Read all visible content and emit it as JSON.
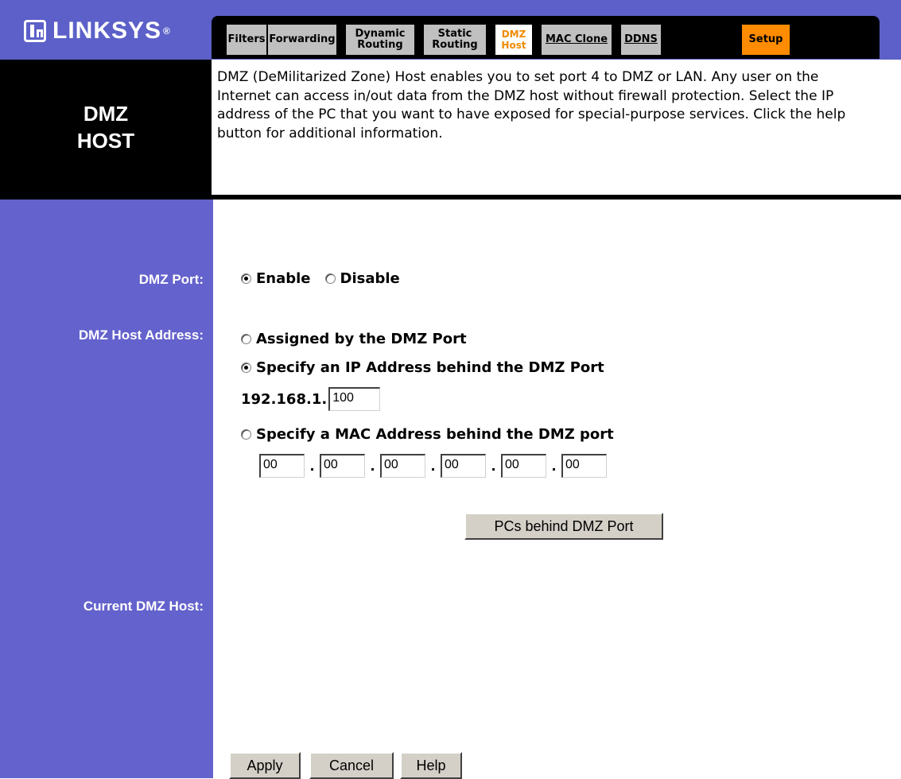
{
  "brand": {
    "name": "LINKSYS",
    "reg_mark": "®"
  },
  "nav": {
    "tabs": [
      {
        "label": "Filters"
      },
      {
        "label": "Forwarding"
      },
      {
        "label": "Dynamic\nRouting"
      },
      {
        "label": "Static\nRouting"
      },
      {
        "label": "DMZ\nHost",
        "active": true
      },
      {
        "label": "MAC Clone"
      },
      {
        "label": "DDNS"
      },
      {
        "label": "Setup"
      }
    ]
  },
  "section": {
    "title": "DMZ\nHOST",
    "description": "DMZ (DeMilitarized Zone) Host enables you to set port 4 to DMZ or LAN. Any user on the Internet can access in/out data from the DMZ host without firewall protection. Select the IP address of the PC that you want to have exposed for special-purpose services. Click the help button for additional information."
  },
  "form": {
    "dmz_port": {
      "label": "DMZ Port:",
      "options": [
        "Enable",
        "Disable"
      ],
      "selected": "Enable"
    },
    "dmz_host_address": {
      "label": "DMZ Host Address:",
      "opt_assigned": "Assigned by the DMZ Port",
      "opt_ip": "Specify an IP Address behind the DMZ Port",
      "opt_mac": "Specify a MAC Address behind the DMZ port",
      "selected": "ip",
      "ip_prefix": "192.168.1.",
      "ip_last_octet": "100",
      "mac": [
        "00",
        "00",
        "00",
        "00",
        "00",
        "00"
      ],
      "mac_separator": "."
    },
    "pcs_button": "PCs behind DMZ Port",
    "current_dmz_host": {
      "label": "Current DMZ Host:",
      "value": ""
    }
  },
  "actions": {
    "apply": "Apply",
    "cancel": "Cancel",
    "help": "Help"
  },
  "colors": {
    "sidebar_blue": "#6462cc",
    "header_blue": "#5c60c8",
    "active_tab_text": "#f08a00",
    "setup_tab_bg": "#ff8c00"
  }
}
